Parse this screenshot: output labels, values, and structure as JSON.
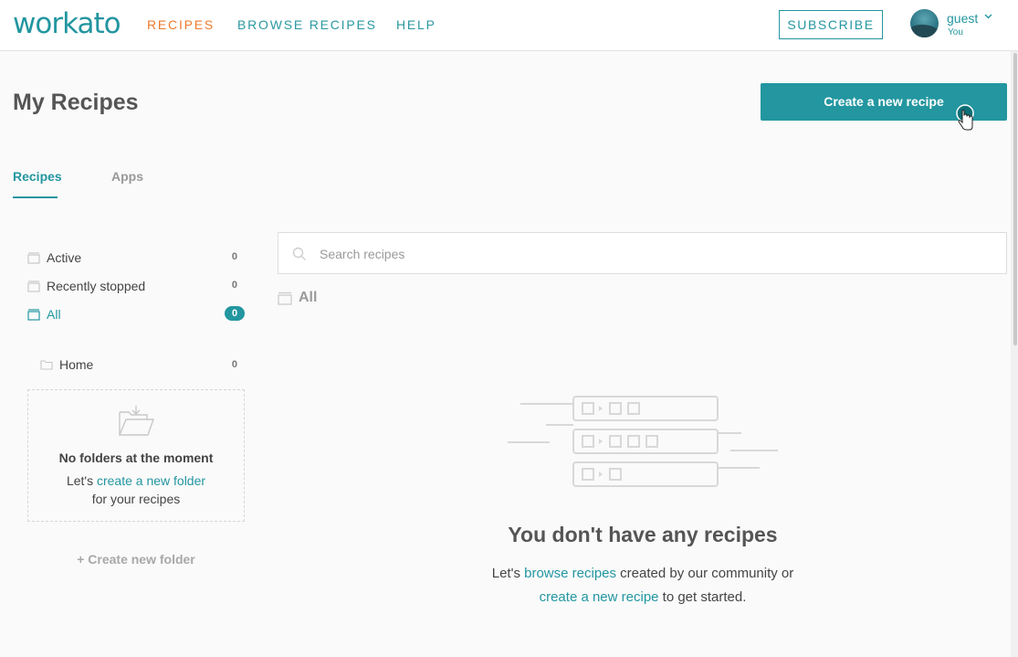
{
  "brand": {
    "logo_text": "workato",
    "accent": "#2396a0",
    "active_nav": "#ec7a2d"
  },
  "nav": {
    "recipes": "RECIPES",
    "browse_recipes": "BROWSE RECIPES",
    "help": "HELP",
    "subscribe": "SUBSCRIBE"
  },
  "user": {
    "name": "guest",
    "subtitle": "You",
    "caret_icon": "chevron-down-icon"
  },
  "page": {
    "title": "My Recipes",
    "create_button": "Create a new recipe"
  },
  "tabs": [
    {
      "label": "Recipes",
      "active": true
    },
    {
      "label": "Apps",
      "active": false
    }
  ],
  "sidebar": {
    "filters": [
      {
        "label": "Active",
        "count": "0",
        "icon": "box-icon",
        "active": false
      },
      {
        "label": "Recently stopped",
        "count": "0",
        "icon": "box-icon",
        "active": false
      },
      {
        "label": "All",
        "count": "0",
        "icon": "box-icon",
        "active": true
      }
    ],
    "folders": [
      {
        "label": "Home",
        "count": "0",
        "icon": "folder-icon"
      }
    ],
    "empty": {
      "title": "No folders at the moment",
      "prefix": "Let's ",
      "link": "create a new folder",
      "suffix": "for your recipes"
    },
    "create_folder": "+ Create new folder"
  },
  "main": {
    "search_placeholder": "Search recipes",
    "section_title": "All",
    "empty": {
      "title": "You don't have any recipes",
      "line1_prefix": "Let's ",
      "line1_link": "browse recipes",
      "line1_suffix": " created by our community or",
      "line2_link": "create a new recipe",
      "line2_suffix": " to get started."
    }
  }
}
